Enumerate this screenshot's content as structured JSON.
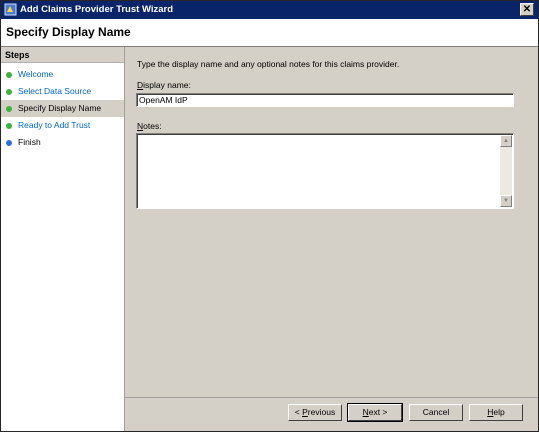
{
  "window": {
    "title": "Add Claims Provider Trust Wizard",
    "close_glyph": "✕"
  },
  "header": {
    "title": "Specify Display Name"
  },
  "steps": {
    "heading": "Steps",
    "items": [
      {
        "label": "Welcome",
        "state": "done",
        "color": "#0066cc",
        "dot": "#3cb43c"
      },
      {
        "label": "Select Data Source",
        "state": "done",
        "color": "#0066cc",
        "dot": "#3cb43c"
      },
      {
        "label": "Specify Display Name",
        "state": "current",
        "color": "#000000",
        "dot": "#3cb43c"
      },
      {
        "label": "Ready to Add Trust",
        "state": "pending",
        "color": "#0066cc",
        "dot": "#3cb43c"
      },
      {
        "label": "Finish",
        "state": "pending",
        "color": "#000000",
        "dot": "#2f6fd6"
      }
    ]
  },
  "main": {
    "instruction": "Type the display name and any optional notes for this claims provider.",
    "display_name_label": "Display name:",
    "display_name_value": "OpenAM IdP",
    "notes_label": "Notes:",
    "notes_value": ""
  },
  "buttons": {
    "previous": "< Previous",
    "next": "Next >",
    "cancel": "Cancel",
    "help": "Help"
  }
}
